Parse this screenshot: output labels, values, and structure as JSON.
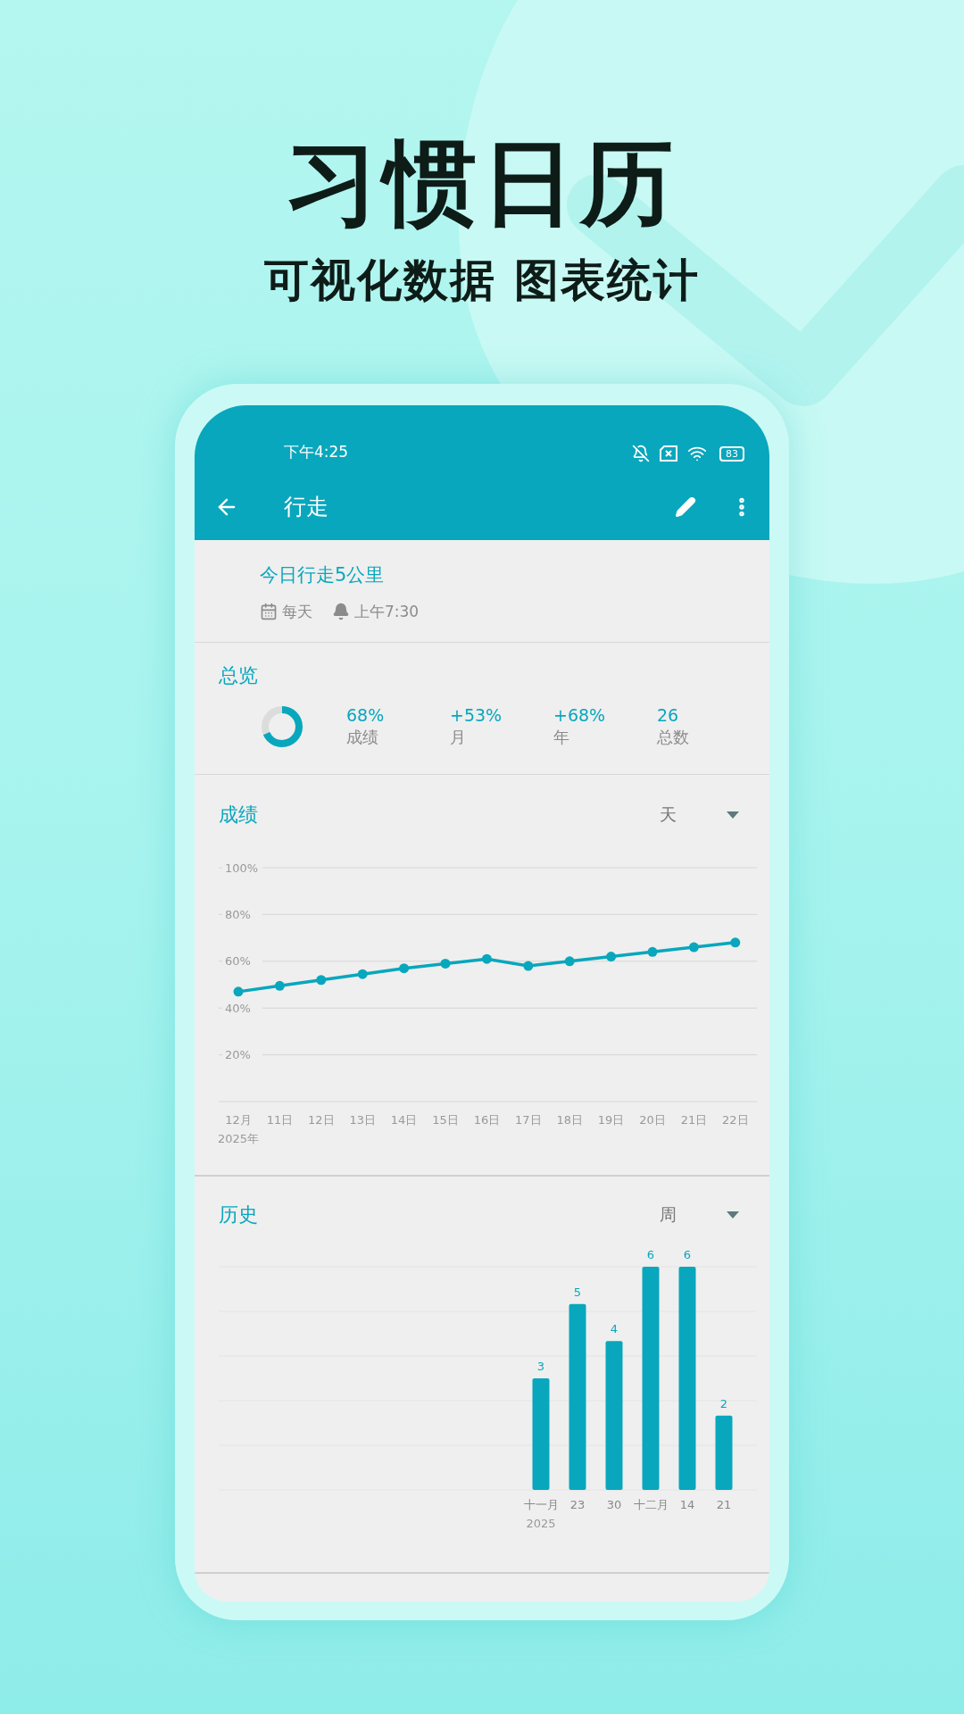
{
  "promo": {
    "title": "习惯日历",
    "subtitle": "可视化数据 图表统计"
  },
  "status_bar": {
    "time": "下午4:25",
    "battery": "83"
  },
  "app_bar": {
    "title": "行走"
  },
  "habit": {
    "name": "今日行走5公里",
    "frequency": "每天",
    "reminder": "上午7:30"
  },
  "overview": {
    "title": "总览",
    "level": 0.68,
    "stats": [
      {
        "value": "68%",
        "label": "成绩"
      },
      {
        "value": "+53%",
        "label": "月"
      },
      {
        "value": "+68%",
        "label": "年"
      },
      {
        "value": "26",
        "label": "总数"
      }
    ]
  },
  "score": {
    "title": "成绩",
    "period": "天",
    "year_label": "2025年",
    "chart_data": {
      "type": "line",
      "categories": [
        "12月",
        "11日",
        "12日",
        "13日",
        "14日",
        "15日",
        "16日",
        "17日",
        "18日",
        "19日",
        "20日",
        "21日",
        "22日"
      ],
      "ylim": [
        0,
        100
      ],
      "grid": true,
      "yticks": [
        {
          "value": 20,
          "label": "20%"
        },
        {
          "value": 40,
          "label": "40%"
        },
        {
          "value": 60,
          "label": "60%"
        },
        {
          "value": 80,
          "label": "80%"
        },
        {
          "value": 100,
          "label": "100%"
        }
      ],
      "series": [
        {
          "color": "#08a7bd",
          "marker": "circle",
          "values": [
            47,
            49.5,
            52,
            54.5,
            57,
            59,
            61,
            58,
            60,
            62,
            64,
            66,
            68
          ]
        }
      ]
    }
  },
  "history": {
    "title": "历史",
    "period": "周",
    "year_label": "2025",
    "chart_data": {
      "type": "bar",
      "categories": [
        "十一月",
        "23",
        "30",
        "十二月",
        "14",
        "21"
      ],
      "ylim": [
        0,
        6
      ],
      "data_labels": true,
      "series": [
        {
          "color": "#08a7bd",
          "values": [
            3,
            5,
            4,
            6,
            6,
            2
          ]
        }
      ]
    }
  }
}
